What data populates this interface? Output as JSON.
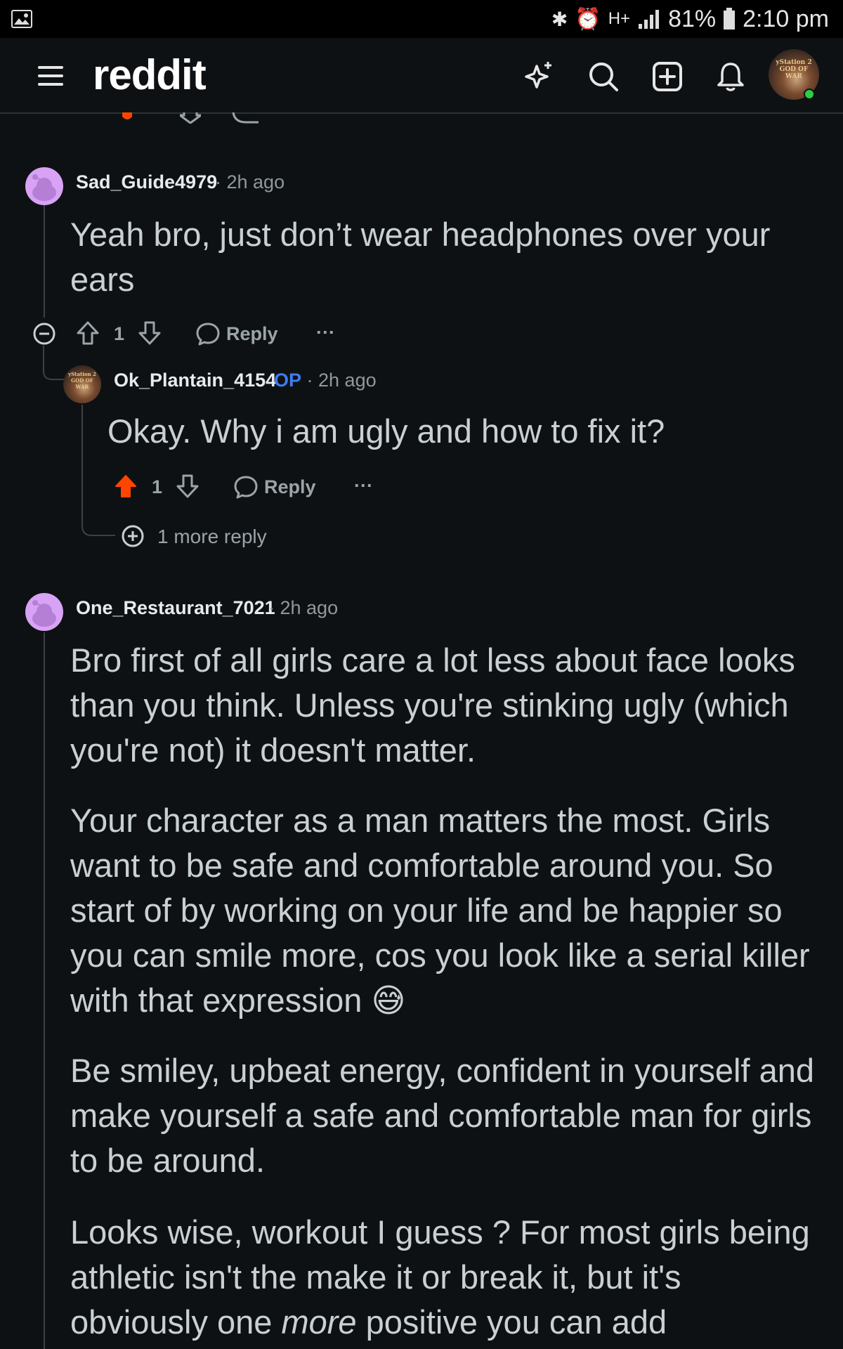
{
  "status_bar": {
    "battery": "81%",
    "time": "2:10 pm",
    "network": "H+"
  },
  "header": {
    "logo": "reddit",
    "avatar_label": "yStation 2 GOD OF WAR"
  },
  "comments": [
    {
      "username": "Sad_Guide4979",
      "time": "2h ago",
      "body": "Yeah bro, just don’t wear headphones over your ears",
      "votes": "1",
      "reply_label": "Reply",
      "more_label": "···"
    },
    {
      "username": "Ok_Plantain_4154",
      "op_badge": "OP",
      "time": "2h ago",
      "body": "Okay. Why i am ugly and how to fix it?",
      "votes": "1",
      "reply_label": "Reply",
      "more_label": "···",
      "more_replies": "1 more reply"
    },
    {
      "username": "One_Restaurant_7021",
      "time": "2h ago",
      "paragraphs": [
        "Bro first of all girls care a lot less about face looks than you think. Unless you're stinking ugly (which you're not) it doesn't matter.",
        "Your character as a man matters the most. Girls want to be safe and comfortable around you. So start of by working on your life and be happier so you can smile more, cos you look like a serial killer with that expression 😅",
        "Be smiley, upbeat energy, confident in yourself and make yourself a safe and comfortable man for girls to be around.",
        "Looks wise, workout I guess ? For most girls being athletic isn't the make it or break it, but it's obviously one"
      ],
      "last_em": "more",
      "last_tail": "positive you can add"
    }
  ],
  "colors": {
    "background": "#0e1113",
    "upvote_active": "#ff4500",
    "op_badge": "#3d7cf0",
    "snoo_avatar": "#d8a3f5"
  }
}
